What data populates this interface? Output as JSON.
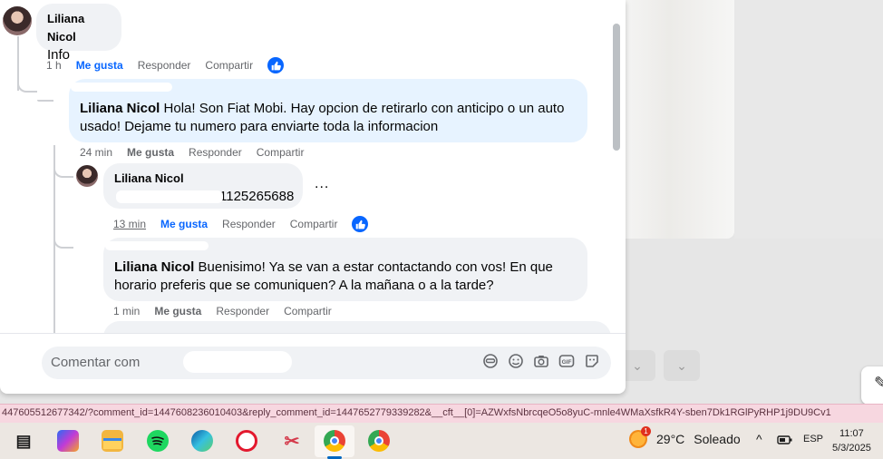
{
  "comments": {
    "top": {
      "author": "Liliana Nicol",
      "text": "Info",
      "time": "1 h",
      "like": "Me gusta",
      "reply": "Responder",
      "share": "Compartir"
    },
    "reply1": {
      "author": "Liliana Nicol",
      "text": "Hola! Son Fiat Mobi. Hay opcion de retirarlo con anticipo o un auto usado! Dejame tu numero para enviarte toda la informacion",
      "time": "24 min",
      "like": "Me gusta",
      "reply": "Responder",
      "share": "Compartir"
    },
    "reply2": {
      "author": "Liliana Nicol",
      "text": "1125265688",
      "more": "...",
      "time": "13 min",
      "like": "Me gusta",
      "reply": "Responder",
      "share": "Compartir"
    },
    "reply3": {
      "author": "Liliana Nicol",
      "text": "Buenisimo! Ya se van a estar contactando con vos! En que horario preferis que se comuniquen? A la mañana o a la tarde?",
      "time": "1 min",
      "like": "Me gusta",
      "reply": "Responder",
      "share": "Compartir"
    }
  },
  "composer": {
    "placeholder": "Comentar com",
    "tools": [
      "avatar-sticker-icon",
      "emoji-icon",
      "camera-icon",
      "gif-icon",
      "sticker-icon"
    ],
    "gif_label": "GIF"
  },
  "status_url": "447605512677342/?comment_id=1447608236010403&reply_comment_id=1447652779339282&__cft__[0]=AZWxfsNbrcqeO5o8yuC-mnle4WMaXsfkR4Y-sben7Dk1RGlPyRHP1j9DU9Cv1",
  "taskbar": {
    "weather_temp": "29°C",
    "weather_desc": "Soleado",
    "weather_badge": "1",
    "language": "ESP",
    "time": "11:07",
    "date": "5/3/2025"
  },
  "colors": {
    "accent": "#0866ff",
    "bubble_gray": "#f0f2f5",
    "bubble_blue": "#e7f3ff",
    "meta_gray": "#65676b"
  }
}
